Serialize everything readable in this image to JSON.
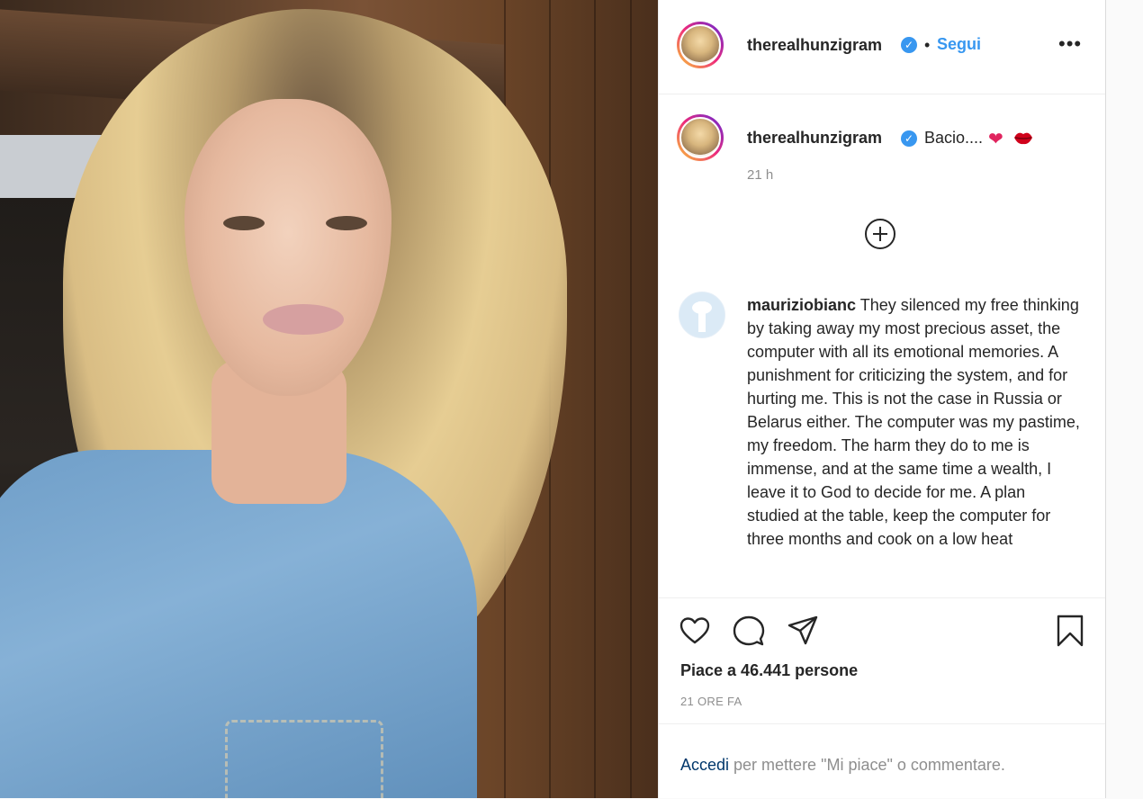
{
  "post": {
    "author": "therealhunzigram",
    "separator": "•",
    "follow_label": "Segui",
    "more_label": "•••",
    "verified_mark": "✓"
  },
  "caption": {
    "author": "therealhunzigram",
    "text": "Bacio....",
    "heart": "❤",
    "time": "21 h"
  },
  "comment": {
    "author": "mauriziobianc",
    "text": "They silenced my free thinking by taking away my most precious asset, the computer with all its emotional memories. A punishment for criticizing the system, and for hurting me. This is not the case in Russia or Belarus either. The computer was my pastime, my freedom. The harm they do to me is immense, and at the same time a wealth, I leave it to God to decide for me. A plan studied at the table, keep the computer for three months and cook on a low heat"
  },
  "actions": {
    "likes": "Piace a 46.441 persone",
    "posted_ago": "21 ORE FA"
  },
  "login": {
    "link": "Accedi",
    "rest": " per mettere \"Mi piace\" o commentare."
  },
  "icons": [
    "like-icon",
    "comment-icon",
    "share-icon",
    "save-icon",
    "load-more-icon",
    "verified-icon",
    "more-options-icon"
  ],
  "colors": {
    "accent": "#3897f0",
    "text": "#262626",
    "muted": "#8e8e8e",
    "link": "#00376b"
  }
}
